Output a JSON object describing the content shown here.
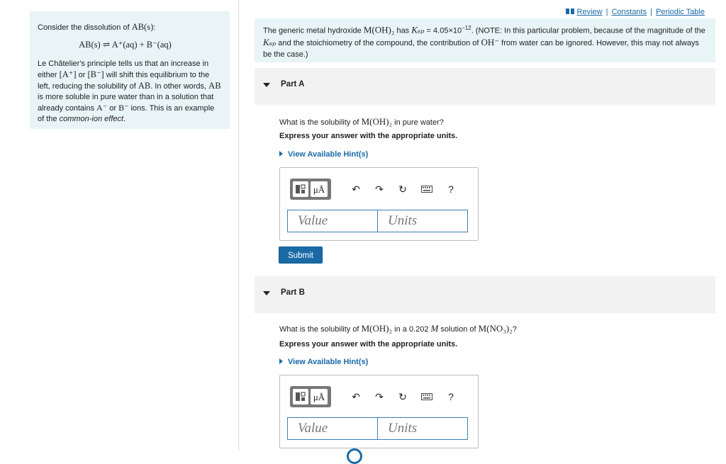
{
  "intro": {
    "line1_text": "Consider the dissolution of ",
    "line1_math": "AB(s)",
    "line1_colon": ":",
    "equation": "AB(s) ⇌ A⁺(aq) + B⁻(aq)",
    "para_1": "Le Châtelier's principle tells us that an increase in either ",
    "a_plus": "[A⁺]",
    "or_word": " or ",
    "b_minus": "[B⁻]",
    "para_2": " will shift this equilibrium to the left, reducing the solubility of ",
    "ab_1": "AB",
    "para_3": ". In other words, ",
    "ab_2": "AB",
    "para_4": " is more soluble in pure water than in a solution that already contains ",
    "a_minus": "A⁻",
    "or_word_2": " or ",
    "b_minus_2": "B⁻",
    "para_5": " ions. This is an example of the ",
    "emph": "common-ion effect",
    "period": "."
  },
  "links": {
    "review": "Review",
    "constants": "Constants",
    "periodic": "Periodic Table",
    "sep": "|"
  },
  "problem": {
    "t1": "The generic metal hydroxide ",
    "compound": "M(OH)₂",
    "t2": " has ",
    "ksp": "Kₛₚ",
    "t3": " = 4.05×10",
    "exp": "−12",
    "t4": ". (NOTE: In this particular problem, because of the magnitude of the ",
    "ksp2": "Kₛₚ",
    "t5": " and the stoichiometry of the compound, the contribution of ",
    "oh": "OH⁻",
    "t6": " from water can be ignored. However, this may not always be the case.)"
  },
  "part_a": {
    "label": "Part A",
    "question_1": "What is the solubility of ",
    "question_compound": "M(OH)₂",
    "question_2": " in pure water?",
    "instruction": "Express your answer with the appropriate units.",
    "hint_label": "View Available Hint(s)",
    "value_placeholder": "Value",
    "units_placeholder": "Units",
    "submit_label": "Submit"
  },
  "part_b": {
    "label": "Part B",
    "question_1": "What is the solubility of ",
    "question_compound": "M(OH)₂",
    "question_2": " in a 0.202 ",
    "molar": "M",
    "question_3": " solution of ",
    "salt": "M(NO₃)₂",
    "question_4": "?",
    "instruction": "Express your answer with the appropriate units.",
    "hint_label": "View Available Hint(s)",
    "value_placeholder": "Value",
    "units_placeholder": "Units"
  },
  "toolbar": {
    "units_symbol": "μÅ",
    "undo_icon": "↶",
    "redo_icon": "↷",
    "reset_icon": "↻",
    "help_label": "?"
  },
  "icons": [
    "book-icon",
    "template-icon",
    "units-icon",
    "undo-icon",
    "redo-icon",
    "reset-icon",
    "keyboard-icon",
    "help-icon",
    "collapse-triangle-icon",
    "hint-arrow-icon"
  ],
  "colors": {
    "accent": "#1a6aa6",
    "panel": "#e8f4f6",
    "part_header": "#f2f2f2"
  }
}
